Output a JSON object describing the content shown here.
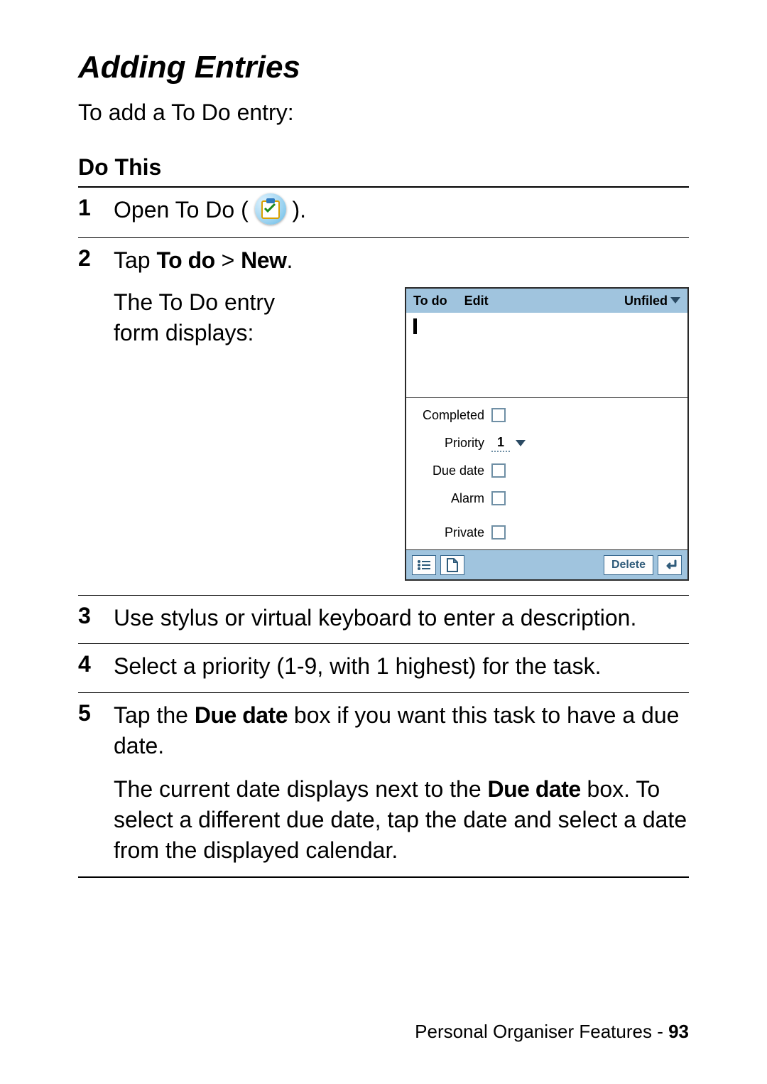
{
  "title": "Adding Entries",
  "intro": "To add a To Do entry:",
  "do_this_header": "Do This",
  "steps": {
    "s1": {
      "num": "1",
      "pre": "Open To Do ( ",
      "post": " )."
    },
    "s2": {
      "num": "2",
      "tap": "Tap ",
      "menu1": "To do",
      "sep": " > ",
      "menu2": "New",
      "dot": ".",
      "desc": "The To Do entry form displays:"
    },
    "s3": {
      "num": "3",
      "text": "Use stylus or virtual keyboard to enter a description."
    },
    "s4": {
      "num": "4",
      "text": "Select a priority (1-9, with 1 highest) for the task."
    },
    "s5": {
      "num": "5",
      "p1a": "Tap the ",
      "p1b": "Due date",
      "p1c": " box if you want this task to have a due date.",
      "p2a": "The current date displays next to the ",
      "p2b": "Due date",
      "p2c": " box. To select a different due date, tap the date and select a date from the displayed calendar."
    }
  },
  "device": {
    "menu_todo": "To do",
    "menu_edit": "Edit",
    "category": "Unfiled",
    "fields": {
      "completed": "Completed",
      "priority": "Priority",
      "priority_value": "1",
      "due_date": "Due date",
      "alarm": "Alarm",
      "private": "Private"
    },
    "buttons": {
      "delete": "Delete"
    }
  },
  "footer": {
    "section": "Personal Organiser Features",
    "sep": " - ",
    "page": "93"
  }
}
